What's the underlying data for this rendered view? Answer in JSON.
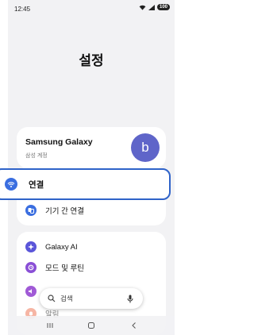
{
  "status_bar": {
    "time": "12:45",
    "battery": "100"
  },
  "header": {
    "title": "설정"
  },
  "account": {
    "name": "Samsung Galaxy",
    "subtitle": "삼성 계정",
    "avatar_letter": "b"
  },
  "connections": {
    "label": "연결",
    "icon": "wifi-icon"
  },
  "settings_items": [
    {
      "label": "기기 간 연결",
      "icon": "device-connect-icon",
      "color": "#3a6ee0"
    },
    {
      "label": "Galaxy AI",
      "icon": "ai-sparkle-icon",
      "color": "#5a55d9"
    },
    {
      "label": "모드 및 루틴",
      "icon": "routine-icon",
      "color": "#8a4fd6"
    },
    {
      "label": "",
      "icon": "sound-icon",
      "color": "#a05ad6"
    },
    {
      "label": "알림",
      "icon": "bell-icon",
      "color": "#f07a5a"
    }
  ],
  "search": {
    "placeholder": "검색"
  },
  "colors": {
    "accent": "#2f63c9",
    "avatar": "#5f65c9"
  }
}
